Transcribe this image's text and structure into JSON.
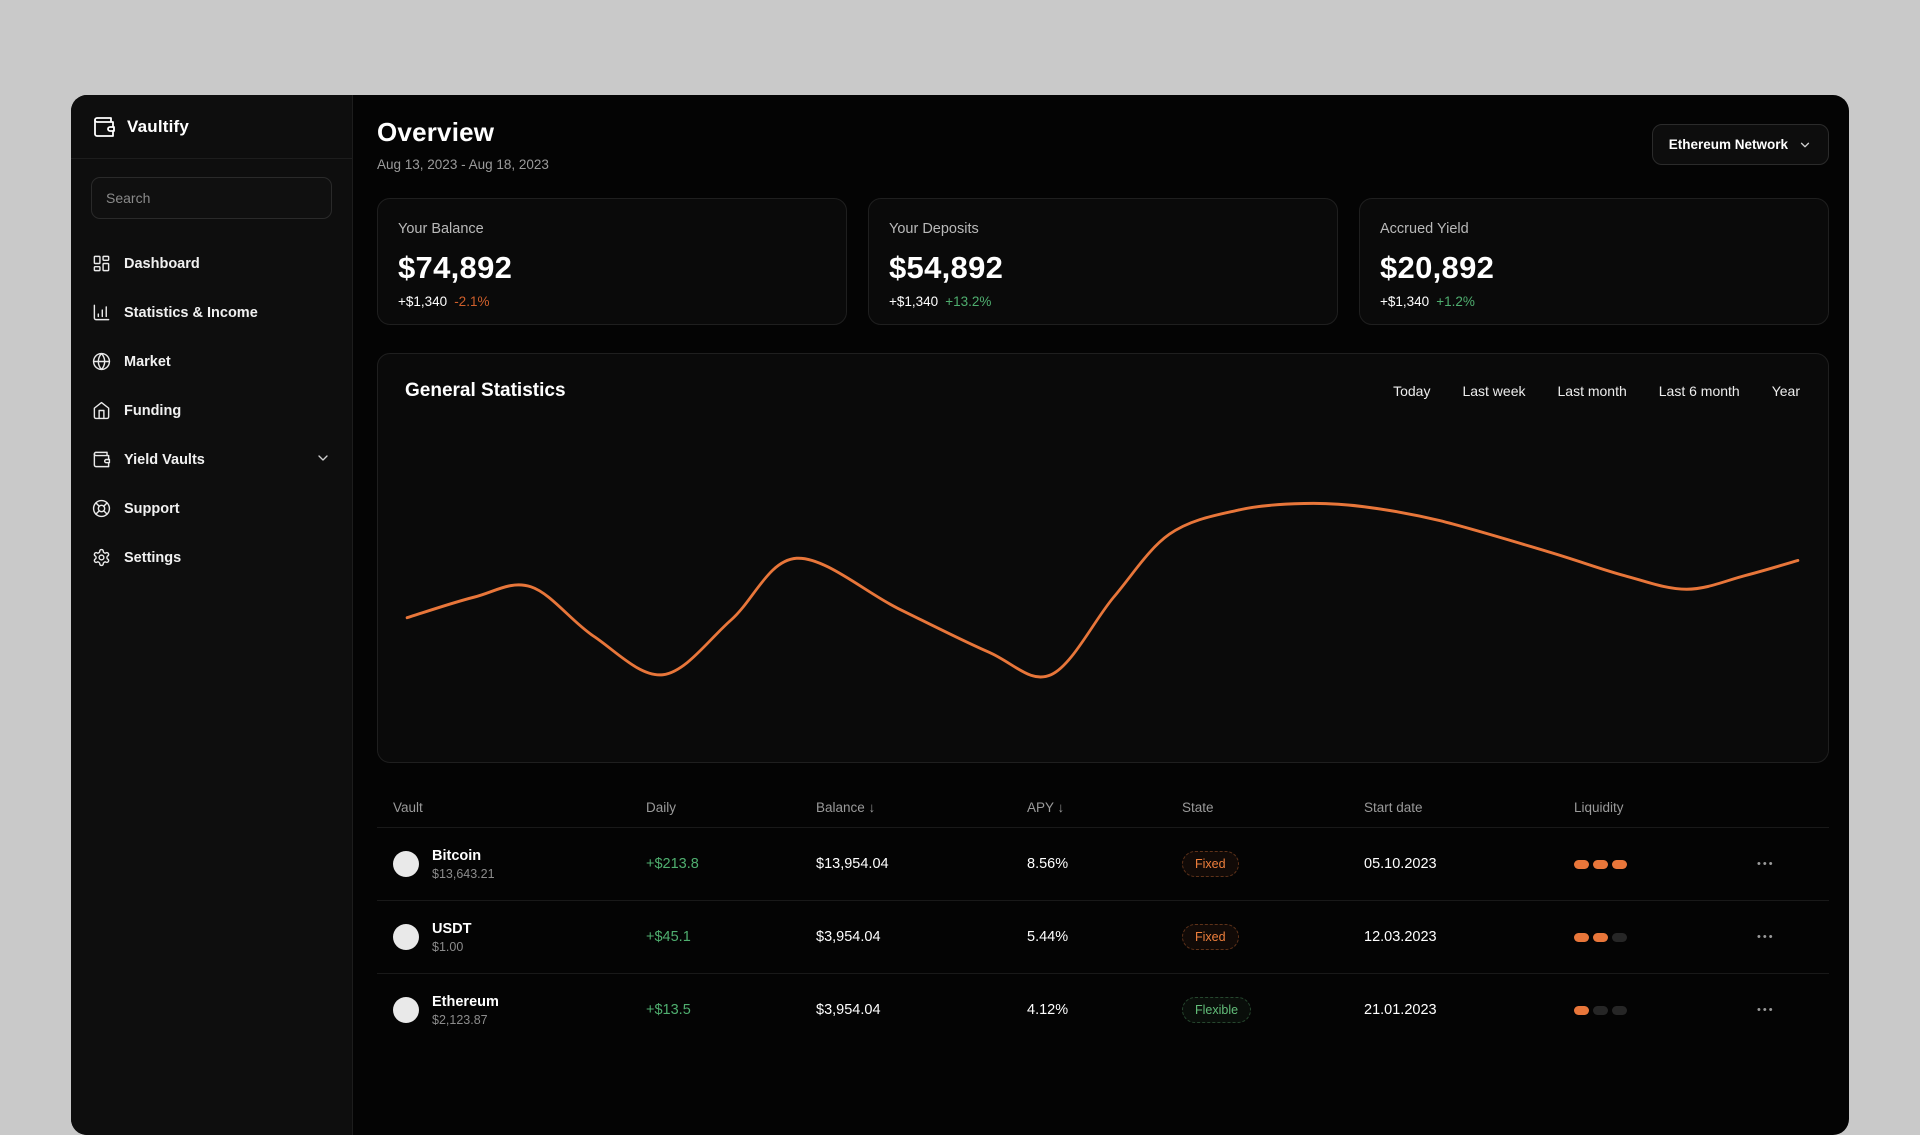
{
  "brand": {
    "name": "Vaultify"
  },
  "sidebar": {
    "search_placeholder": "Search",
    "items": [
      {
        "label": "Dashboard"
      },
      {
        "label": "Statistics & Income"
      },
      {
        "label": "Market"
      },
      {
        "label": "Funding"
      },
      {
        "label": "Yield Vaults"
      },
      {
        "label": "Support"
      },
      {
        "label": "Settings"
      }
    ]
  },
  "header": {
    "title": "Overview",
    "date_range": "Aug 13, 2023 - Aug 18, 2023",
    "network_button": "Ethereum Network"
  },
  "stat_cards": [
    {
      "label": "Your Balance",
      "value": "$74,892",
      "delta": "+$1,340",
      "pct": "-2.1%",
      "pct_color": "#cf5f2b"
    },
    {
      "label": "Your Deposits",
      "value": "$54,892",
      "delta": "+$1,340",
      "pct": "+13.2%",
      "pct_color": "#4fae6f"
    },
    {
      "label": "Accrued Yield",
      "value": "$20,892",
      "delta": "+$1,340",
      "pct": "+1.2%",
      "pct_color": "#4fae6f"
    }
  ],
  "statistics_panel": {
    "title": "General Statistics",
    "filters": [
      "Today",
      "Last week",
      "Last month",
      "Last 6 month",
      "Year"
    ]
  },
  "chart_data": {
    "type": "line",
    "title": "General Statistics",
    "legend": [],
    "grid": false,
    "line_color": "#e8763a",
    "x_range": [
      0,
      100
    ],
    "y_range": [
      0,
      100
    ],
    "points": [
      [
        0,
        40.7
      ],
      [
        4.8,
        47.1
      ],
      [
        8.9,
        50.4
      ],
      [
        13.4,
        35.0
      ],
      [
        18.4,
        22.9
      ],
      [
        23.3,
        40.0
      ],
      [
        28.0,
        59.3
      ],
      [
        35.3,
        43.6
      ],
      [
        41.8,
        30.0
      ],
      [
        46.3,
        22.9
      ],
      [
        50.8,
        47.1
      ],
      [
        54.8,
        66.8
      ],
      [
        59.7,
        74.3
      ],
      [
        64.5,
        76.4
      ],
      [
        68.8,
        75.4
      ],
      [
        74.2,
        71.1
      ],
      [
        82.0,
        61.4
      ],
      [
        87.5,
        53.9
      ],
      [
        92.0,
        49.6
      ],
      [
        96.2,
        53.9
      ],
      [
        100,
        58.6
      ]
    ]
  },
  "table": {
    "columns": [
      "Vault",
      "Daily",
      "Balance ↓",
      "APY ↓",
      "State",
      "Start date",
      "Liquidity"
    ],
    "actions_label": "●●●",
    "liquidity_max": 3,
    "rows": [
      {
        "name": "Bitcoin",
        "price": "$13,643.21",
        "daily": "+$213.8",
        "balance": "$13,954.04",
        "apy": "8.56%",
        "state": "Fixed",
        "state_type": "fixed",
        "start_date": "05.10.2023",
        "liquidity": 3
      },
      {
        "name": "USDT",
        "price": "$1.00",
        "daily": "+$45.1",
        "balance": "$3,954.04",
        "apy": "5.44%",
        "state": "Fixed",
        "state_type": "fixed",
        "start_date": "12.03.2023",
        "liquidity": 2
      },
      {
        "name": "Ethereum",
        "price": "$2,123.87",
        "daily": "+$13.5",
        "balance": "$3,954.04",
        "apy": "4.12%",
        "state": "Flexible",
        "state_type": "flexible",
        "start_date": "21.01.2023",
        "liquidity": 1
      }
    ]
  },
  "colors": {
    "accent_orange": "#e8763a",
    "positive_green": "#4fae6f",
    "negative_orange": "#cf5f2b"
  }
}
